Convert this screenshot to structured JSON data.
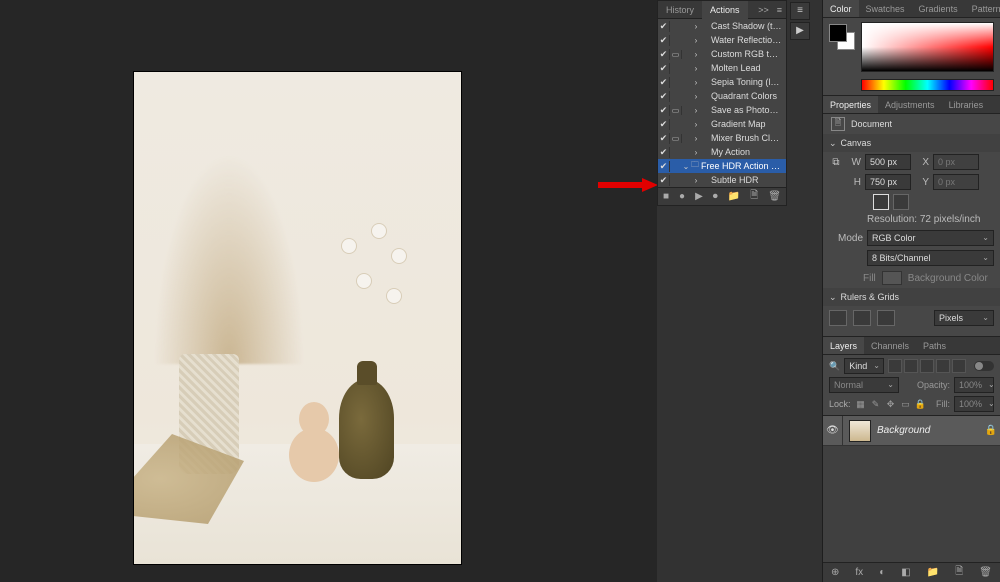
{
  "actions_panel": {
    "tabs": [
      "History",
      "Actions"
    ],
    "active_tab": 1,
    "menu_glyph": ">>",
    "items": [
      {
        "checked": true,
        "modal": false,
        "indent": 1,
        "expand": "›",
        "folder": false,
        "label": "Cast Shadow (type)"
      },
      {
        "checked": true,
        "modal": false,
        "indent": 1,
        "expand": "›",
        "folder": false,
        "label": "Water Reflection (type)"
      },
      {
        "checked": true,
        "modal": true,
        "indent": 1,
        "expand": "›",
        "folder": false,
        "label": "Custom RGB to Grayscale"
      },
      {
        "checked": true,
        "modal": false,
        "indent": 1,
        "expand": "›",
        "folder": false,
        "label": "Molten Lead"
      },
      {
        "checked": true,
        "modal": false,
        "indent": 1,
        "expand": "›",
        "folder": false,
        "label": "Sepia Toning (layer)"
      },
      {
        "checked": true,
        "modal": false,
        "indent": 1,
        "expand": "›",
        "folder": false,
        "label": "Quadrant Colors"
      },
      {
        "checked": true,
        "modal": true,
        "indent": 1,
        "expand": "›",
        "folder": false,
        "label": "Save as Photoshop PDF"
      },
      {
        "checked": true,
        "modal": false,
        "indent": 1,
        "expand": "›",
        "folder": false,
        "label": "Gradient Map"
      },
      {
        "checked": true,
        "modal": true,
        "indent": 1,
        "expand": "›",
        "folder": false,
        "label": "Mixer Brush Cloning Paint …"
      },
      {
        "checked": true,
        "modal": false,
        "indent": 1,
        "expand": "›",
        "folder": false,
        "label": "My Action"
      },
      {
        "checked": true,
        "modal": false,
        "indent": 0,
        "expand": "⌄",
        "folder": true,
        "label": "Free HDR Action - Photog…",
        "selected": true
      },
      {
        "checked": true,
        "modal": false,
        "indent": 1,
        "expand": "›",
        "folder": false,
        "label": "Subtle HDR"
      }
    ],
    "bottom_icons": [
      "■",
      "●",
      "▶",
      "⏺",
      "📁",
      "🗎",
      "🗑"
    ]
  },
  "float_controls": {
    "buttons": [
      "≡",
      "▶"
    ]
  },
  "color_panel": {
    "tabs": [
      "Color",
      "Swatches",
      "Gradients",
      "Patterns"
    ],
    "active_tab": 0,
    "foreground": "#000000",
    "background": "#ffffff"
  },
  "properties_panel": {
    "tabs": [
      "Properties",
      "Adjustments",
      "Libraries"
    ],
    "active_tab": 0,
    "doc_type_label": "Document",
    "sections": {
      "canvas": {
        "title": "Canvas",
        "W_label": "W",
        "W_value": "500 px",
        "X_label": "X",
        "X_value": "0 px",
        "H_label": "H",
        "H_value": "750 px",
        "Y_label": "Y",
        "Y_value": "0 px",
        "resolution_label": "Resolution:",
        "resolution_value": "72 pixels/inch",
        "mode_label": "Mode",
        "mode_value": "RGB Color",
        "depth_value": "8 Bits/Channel",
        "fill_label": "Fill",
        "fill_text": "Background Color"
      },
      "rulers": {
        "title": "Rulers & Grids",
        "unit_value": "Pixels"
      }
    }
  },
  "layers_panel": {
    "tabs": [
      "Layers",
      "Channels",
      "Paths"
    ],
    "active_tab": 0,
    "kind_label": "Kind",
    "blend_mode": "Normal",
    "opacity_label": "Opacity:",
    "opacity_value": "100%",
    "lock_label": "Lock:",
    "fill_label": "Fill:",
    "fill_value": "100%",
    "layers": [
      {
        "visible": true,
        "name": "Background",
        "locked": true
      }
    ],
    "bottom_icons": [
      "⊕",
      "fx",
      "◐",
      "◧",
      "📁",
      "🗎",
      "🗑"
    ]
  }
}
